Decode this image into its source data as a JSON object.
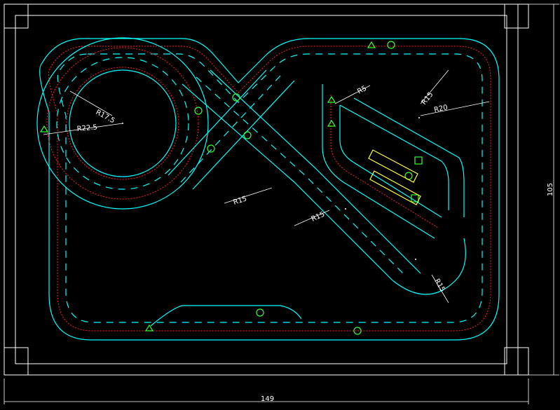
{
  "drawing": {
    "overall_width_label": "149",
    "overall_height_label": "105"
  },
  "radius_labels": [
    {
      "id": "r17-5",
      "text": "R17.5"
    },
    {
      "id": "r22-5",
      "text": "R22.5"
    },
    {
      "id": "r5",
      "text": "R5"
    },
    {
      "id": "r15-a",
      "text": "R15"
    },
    {
      "id": "r20",
      "text": "R20"
    },
    {
      "id": "r15-b",
      "text": "R15"
    },
    {
      "id": "r15-c",
      "text": "R15"
    },
    {
      "id": "r15-d",
      "text": "R15"
    }
  ],
  "colors": {
    "background": "#000000",
    "frame": "#ffffff",
    "track_edge": "#00ffff",
    "rail": "#ff2020",
    "marker": "#33ff33",
    "car": "#ffff33"
  }
}
